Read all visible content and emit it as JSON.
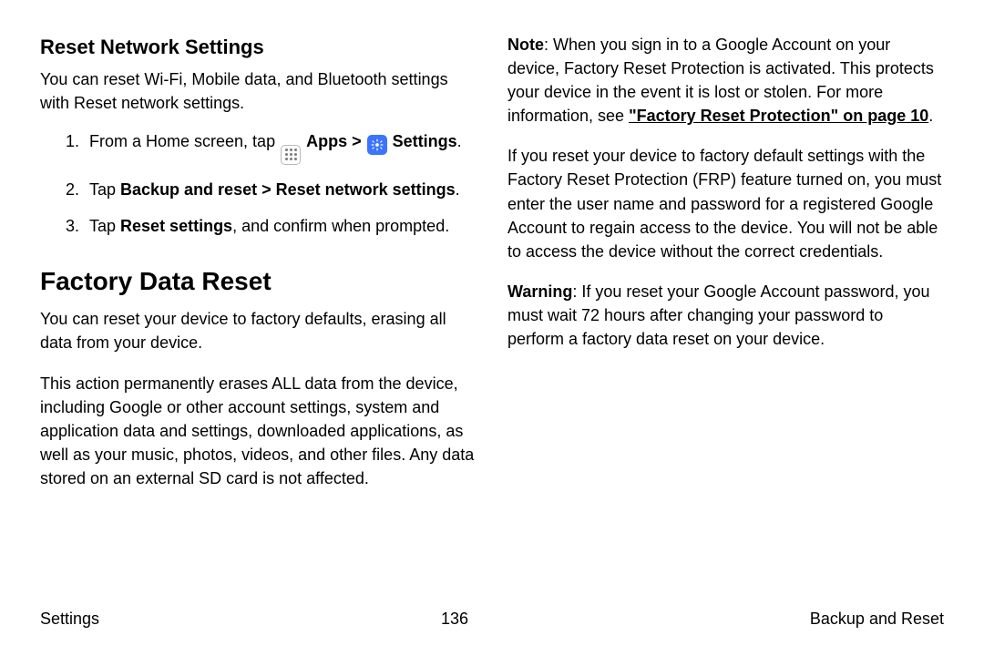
{
  "left": {
    "section1": {
      "title": "Reset Network Settings",
      "intro": "You can reset Wi-Fi, Mobile data, and Bluetooth settings with Reset network settings.",
      "step1_a": "From a Home screen, tap ",
      "step1_apps": " Apps",
      "step1_sep": " > ",
      "step1_settings": " Settings",
      "step1_end": ".",
      "step2_a": "Tap ",
      "step2_b": "Backup and reset > Reset network settings",
      "step2_c": ".",
      "step3_a": "Tap ",
      "step3_b": "Reset settings",
      "step3_c": ", and confirm when prompted."
    },
    "section2": {
      "title": "Factory Data Reset",
      "p1": "You can reset your device to factory defaults, erasing all data from your device.",
      "p2": "This action permanently erases ALL data from the device, including Google or other account settings, system and application data and settings, downloaded applications, as well as your music, photos, videos, and other files. Any data stored on an external SD card is not affected."
    }
  },
  "right": {
    "note_label": "Note",
    "note_body": ": When you sign in to a Google Account on your device, Factory Reset Protection is activated. This protects your device in the event it is lost or stolen. For more information, see ",
    "note_link": "\"Factory Reset Protection\" on page 10",
    "note_end": ".",
    "p2": "If you reset your device to factory default settings with the Factory Reset Protection (FRP) feature turned on, you must enter the user name and password for a registered Google Account to regain access to the device. You will not be able to access the device without the correct credentials.",
    "warn_label": "Warning",
    "warn_body": ": If you reset your Google Account password, you must wait 72 hours after changing your password to perform a factory data reset on your device."
  },
  "footer": {
    "left": "Settings",
    "center": "136",
    "right": "Backup and Reset"
  }
}
